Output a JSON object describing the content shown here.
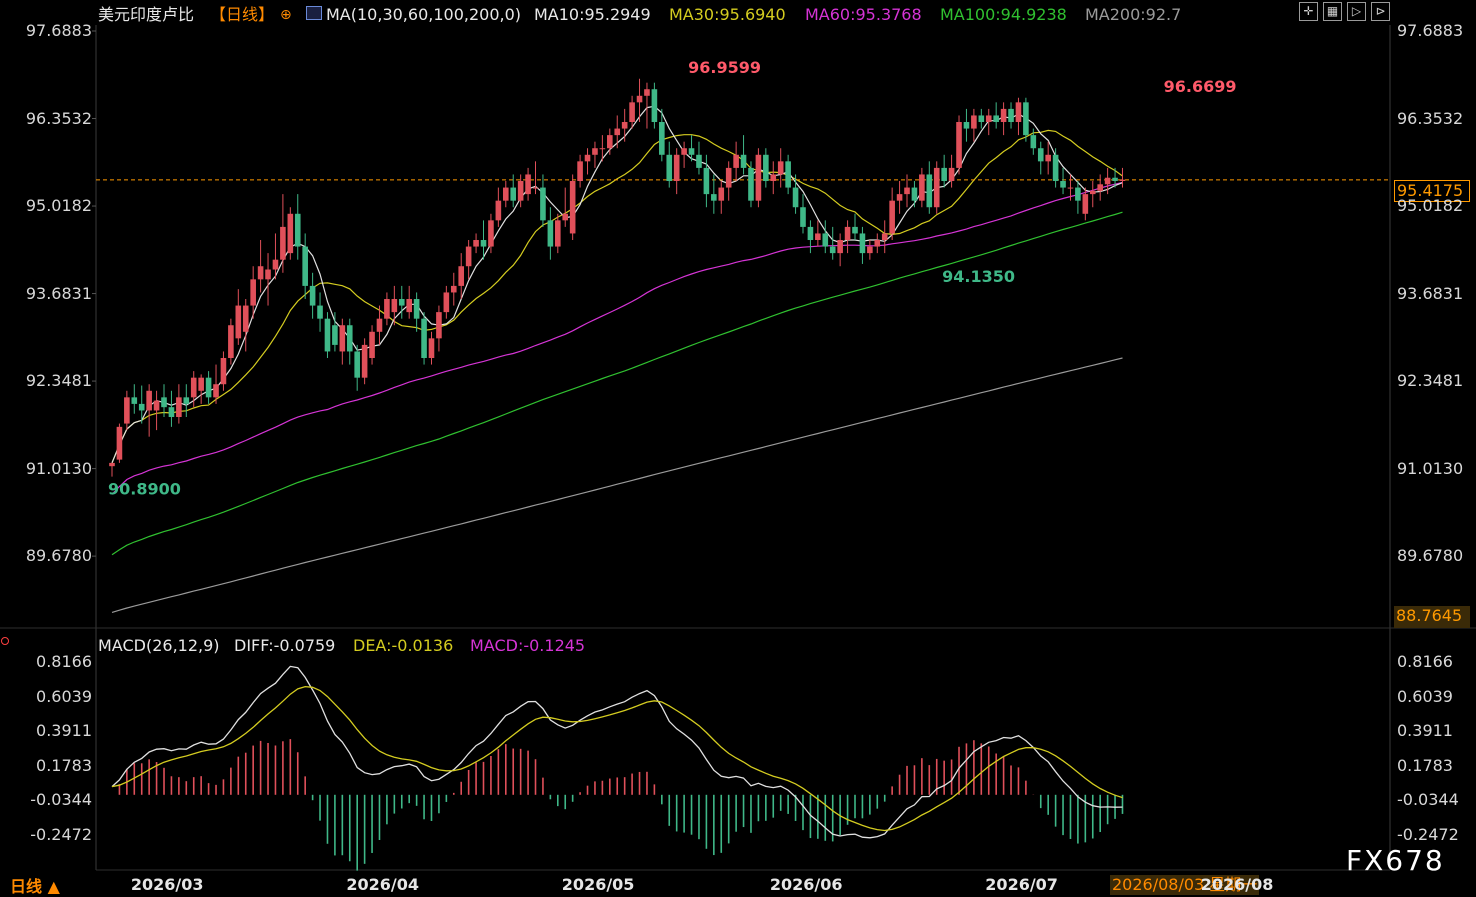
{
  "header": {
    "instrument": "美元印度卢比",
    "period_tag": "【日线】",
    "period_icon": "plus-circle-icon",
    "ma_params": "MA(10,30,60,100,200,0)",
    "ma10": "MA10:95.2949",
    "ma30": "MA30:95.6940",
    "ma60": "MA60:95.3768",
    "ma100": "MA100:94.9238",
    "ma200": "MA200:92.7",
    "toolbar_icons": [
      "crosshair-icon",
      "grid-icon",
      "play-frame-icon",
      "step-frame-icon"
    ]
  },
  "indicator_header": {
    "macd_params": "MACD(26,12,9)",
    "diff": "DIFF:-0.0759",
    "dea": "DEA:-0.0136",
    "macd": "MACD:-0.1245"
  },
  "footer": {
    "period_label": "日线 ▲",
    "cursor_date": "2026/08/03 星期一",
    "watermark": "FX678"
  },
  "colors": {
    "up": "#e0505a",
    "down": "#3fb888",
    "ma10": "#e0e0e0",
    "ma30": "#d4cc20",
    "ma60": "#d534d5",
    "ma100": "#30c030",
    "ma200": "#9a9a9a",
    "diff": "#e0e0e0",
    "dea": "#d4cc20",
    "price_tag": "#ff9a00"
  },
  "chart_data": [
    {
      "type": "candlestick",
      "title": "美元印度卢比【日线】",
      "y_ticks": [
        "97.6883",
        "96.3532",
        "95.0182",
        "93.6831",
        "92.3481",
        "91.0130",
        "89.6780"
      ],
      "y_tick_values": [
        97.6883,
        96.3532,
        95.0182,
        93.6831,
        92.3481,
        91.013,
        89.678
      ],
      "ylim": [
        88.7645,
        97.6883
      ],
      "ylim_label": "88.7645",
      "x_ticks": [
        "2026/03",
        "2026/04",
        "2026/05",
        "2026/06",
        "2026/07",
        "2026/08"
      ],
      "x_tick_index": [
        2,
        31,
        60,
        88,
        117,
        146
      ],
      "last_price": 95.4175,
      "last_price_label": "95.4175",
      "annotations": [
        {
          "index": 77,
          "label": "96.9599",
          "value": 96.9599
        },
        {
          "index": 141,
          "label": "96.6699",
          "value": 96.6699
        },
        {
          "index": 112,
          "label": "94.1350",
          "value": 94.135
        },
        {
          "index": 0,
          "label": "90.8900",
          "value": 90.89
        }
      ],
      "candles": [
        [
          91.05,
          91.1,
          90.89,
          91.1
        ],
        [
          91.15,
          91.7,
          91.1,
          91.65
        ],
        [
          91.7,
          92.2,
          91.6,
          92.1
        ],
        [
          92.1,
          92.3,
          91.85,
          92.0
        ],
        [
          92.0,
          92.28,
          91.7,
          91.9
        ],
        [
          91.9,
          92.3,
          91.5,
          92.2
        ],
        [
          91.9,
          92.2,
          91.6,
          92.05
        ],
        [
          92.1,
          92.3,
          91.8,
          91.95
        ],
        [
          91.95,
          92.2,
          91.65,
          91.8
        ],
        [
          91.8,
          92.3,
          91.7,
          92.1
        ],
        [
          92.1,
          92.3,
          91.8,
          92.0
        ],
        [
          92.1,
          92.5,
          91.95,
          92.4
        ],
        [
          92.2,
          92.45,
          92.0,
          92.4
        ],
        [
          92.4,
          92.5,
          92.0,
          92.1
        ],
        [
          92.1,
          92.6,
          92.0,
          92.3
        ],
        [
          92.3,
          92.8,
          92.2,
          92.7
        ],
        [
          92.7,
          93.3,
          92.6,
          93.2
        ],
        [
          93.0,
          93.75,
          92.9,
          93.5
        ],
        [
          93.1,
          93.6,
          92.8,
          93.5
        ],
        [
          93.5,
          94.1,
          93.3,
          93.9
        ],
        [
          93.9,
          94.5,
          93.7,
          94.1
        ],
        [
          93.9,
          94.3,
          93.5,
          94.05
        ],
        [
          94.05,
          94.6,
          93.9,
          94.2
        ],
        [
          94.2,
          95.2,
          94.0,
          94.7
        ],
        [
          94.3,
          95.0,
          94.2,
          94.9
        ],
        [
          94.9,
          95.2,
          94.2,
          94.4
        ],
        [
          94.4,
          94.6,
          93.6,
          93.8
        ],
        [
          93.8,
          94.0,
          93.3,
          93.5
        ],
        [
          93.5,
          93.7,
          93.1,
          93.3
        ],
        [
          93.3,
          93.4,
          92.7,
          92.8
        ],
        [
          93.2,
          93.4,
          92.8,
          92.9
        ],
        [
          92.8,
          93.3,
          92.6,
          93.2
        ],
        [
          93.2,
          93.3,
          92.6,
          92.8
        ],
        [
          92.8,
          92.9,
          92.2,
          92.4
        ],
        [
          92.4,
          93.0,
          92.3,
          92.9
        ],
        [
          92.7,
          93.2,
          92.6,
          93.1
        ],
        [
          93.1,
          93.5,
          92.9,
          93.3
        ],
        [
          93.3,
          93.7,
          93.2,
          93.6
        ],
        [
          93.4,
          93.8,
          93.2,
          93.6
        ],
        [
          93.6,
          93.8,
          93.3,
          93.5
        ],
        [
          93.4,
          93.8,
          93.3,
          93.6
        ],
        [
          93.6,
          93.7,
          93.1,
          93.3
        ],
        [
          93.3,
          93.4,
          92.6,
          92.7
        ],
        [
          92.7,
          93.1,
          92.6,
          93.0
        ],
        [
          93.0,
          93.5,
          92.8,
          93.4
        ],
        [
          93.4,
          93.8,
          93.3,
          93.7
        ],
        [
          93.7,
          94.0,
          93.5,
          93.8
        ],
        [
          93.8,
          94.3,
          93.6,
          94.1
        ],
        [
          94.1,
          94.5,
          93.9,
          94.4
        ],
        [
          94.4,
          94.6,
          94.3,
          94.5
        ],
        [
          94.5,
          94.8,
          94.2,
          94.4
        ],
        [
          94.4,
          94.9,
          94.3,
          94.8
        ],
        [
          94.8,
          95.3,
          94.7,
          95.1
        ],
        [
          95.1,
          95.4,
          95.0,
          95.3
        ],
        [
          95.3,
          95.5,
          95.0,
          95.1
        ],
        [
          95.1,
          95.5,
          95.0,
          95.4
        ],
        [
          95.2,
          95.6,
          95.1,
          95.5
        ],
        [
          95.3,
          95.7,
          95.2,
          95.3
        ],
        [
          95.3,
          95.5,
          94.7,
          94.8
        ],
        [
          94.8,
          95.0,
          94.2,
          94.4
        ],
        [
          94.4,
          94.9,
          94.3,
          94.8
        ],
        [
          94.8,
          95.3,
          94.7,
          94.9
        ],
        [
          94.6,
          95.5,
          94.5,
          95.4
        ],
        [
          95.4,
          95.8,
          95.3,
          95.7
        ],
        [
          95.7,
          95.9,
          95.5,
          95.8
        ],
        [
          95.8,
          96.0,
          95.6,
          95.9
        ],
        [
          95.9,
          96.1,
          95.7,
          95.9
        ],
        [
          95.9,
          96.2,
          95.8,
          96.1
        ],
        [
          96.1,
          96.4,
          95.9,
          96.2
        ],
        [
          96.2,
          96.5,
          96.0,
          96.3
        ],
        [
          96.3,
          96.7,
          96.2,
          96.6
        ],
        [
          96.6,
          96.96,
          96.3,
          96.7
        ],
        [
          96.7,
          96.9,
          96.2,
          96.8
        ],
        [
          96.8,
          96.9,
          96.2,
          96.3
        ],
        [
          96.3,
          96.5,
          95.7,
          95.8
        ],
        [
          95.8,
          96.0,
          95.3,
          95.4
        ],
        [
          95.4,
          95.9,
          95.2,
          95.8
        ],
        [
          95.8,
          96.0,
          95.6,
          95.9
        ],
        [
          95.9,
          96.1,
          95.7,
          95.8
        ],
        [
          95.8,
          96.0,
          95.5,
          95.6
        ],
        [
          95.6,
          95.8,
          95.0,
          95.2
        ],
        [
          95.2,
          95.5,
          94.9,
          95.1
        ],
        [
          95.1,
          95.4,
          94.9,
          95.3
        ],
        [
          95.3,
          95.7,
          95.1,
          95.6
        ],
        [
          95.6,
          96.0,
          95.4,
          95.8
        ],
        [
          95.8,
          96.1,
          95.5,
          95.6
        ],
        [
          95.6,
          95.7,
          95.0,
          95.1
        ],
        [
          95.1,
          95.9,
          95.0,
          95.8
        ],
        [
          95.8,
          95.9,
          95.3,
          95.4
        ],
        [
          95.4,
          95.7,
          95.2,
          95.5
        ],
        [
          95.5,
          95.9,
          95.3,
          95.7
        ],
        [
          95.7,
          95.8,
          95.2,
          95.3
        ],
        [
          95.3,
          95.5,
          94.9,
          95.0
        ],
        [
          95.0,
          95.2,
          94.6,
          94.7
        ],
        [
          94.7,
          94.8,
          94.3,
          94.5
        ],
        [
          94.5,
          94.8,
          94.4,
          94.6
        ],
        [
          94.6,
          94.8,
          94.3,
          94.4
        ],
        [
          94.4,
          94.7,
          94.2,
          94.3
        ],
        [
          94.3,
          94.6,
          94.1,
          94.5
        ],
        [
          94.5,
          94.8,
          94.3,
          94.7
        ],
        [
          94.7,
          94.9,
          94.5,
          94.6
        ],
        [
          94.6,
          94.7,
          94.135,
          94.3
        ],
        [
          94.3,
          94.5,
          94.2,
          94.4
        ],
        [
          94.4,
          94.6,
          94.3,
          94.5
        ],
        [
          94.5,
          94.8,
          94.3,
          94.6
        ],
        [
          94.6,
          95.3,
          94.5,
          95.1
        ],
        [
          95.1,
          95.4,
          94.9,
          95.2
        ],
        [
          95.2,
          95.5,
          95.0,
          95.3
        ],
        [
          95.3,
          95.4,
          95.0,
          95.1
        ],
        [
          95.1,
          95.6,
          95.0,
          95.5
        ],
        [
          95.5,
          95.7,
          94.9,
          95.0
        ],
        [
          95.0,
          95.7,
          94.9,
          95.6
        ],
        [
          95.6,
          95.8,
          95.3,
          95.4
        ],
        [
          95.4,
          95.8,
          95.3,
          95.6
        ],
        [
          95.6,
          96.4,
          95.5,
          96.3
        ],
        [
          96.3,
          96.5,
          96.0,
          96.2
        ],
        [
          96.2,
          96.5,
          96.0,
          96.4
        ],
        [
          96.4,
          96.5,
          96.2,
          96.3
        ],
        [
          96.3,
          96.5,
          96.1,
          96.4
        ],
        [
          96.4,
          96.6,
          96.2,
          96.3
        ],
        [
          96.3,
          96.6,
          96.1,
          96.5
        ],
        [
          96.5,
          96.6,
          96.2,
          96.3
        ],
        [
          96.3,
          96.67,
          96.1,
          96.6
        ],
        [
          96.6,
          96.67,
          96.0,
          96.1
        ],
        [
          96.1,
          96.2,
          95.8,
          95.9
        ],
        [
          95.9,
          96.0,
          95.5,
          95.7
        ],
        [
          95.7,
          96.0,
          95.5,
          95.8
        ],
        [
          95.8,
          95.9,
          95.3,
          95.4
        ],
        [
          95.4,
          95.6,
          95.2,
          95.3
        ],
        [
          95.3,
          95.5,
          95.1,
          95.3
        ],
        [
          95.3,
          95.4,
          94.9,
          95.1
        ],
        [
          94.9,
          95.3,
          94.8,
          95.2
        ],
        [
          95.2,
          95.4,
          95.0,
          95.25
        ],
        [
          95.25,
          95.5,
          95.1,
          95.35
        ],
        [
          95.35,
          95.6,
          95.2,
          95.45
        ],
        [
          95.45,
          95.6,
          95.3,
          95.4
        ],
        [
          95.4,
          95.6,
          95.3,
          95.42
        ]
      ],
      "ma": {
        "MA10": {
          "start": 95.3,
          "end": 95.29
        },
        "MA30": {
          "end": 95.694
        },
        "MA60": {
          "end": 95.3768
        },
        "MA100": {
          "end": 94.9238
        },
        "MA200": {
          "end": 92.7
        }
      }
    },
    {
      "type": "bar+line",
      "title": "MACD(26,12,9)",
      "y_ticks": [
        "0.8166",
        "0.6039",
        "0.3911",
        "0.1783",
        "-0.0344",
        "-0.2472"
      ],
      "y_tick_values": [
        0.8166,
        0.6039,
        0.3911,
        0.1783,
        -0.0344,
        -0.2472
      ],
      "series": [
        {
          "name": "DIFF",
          "last": -0.0759
        },
        {
          "name": "DEA",
          "last": -0.0136
        },
        {
          "name": "MACD",
          "last": -0.1245
        }
      ]
    }
  ]
}
